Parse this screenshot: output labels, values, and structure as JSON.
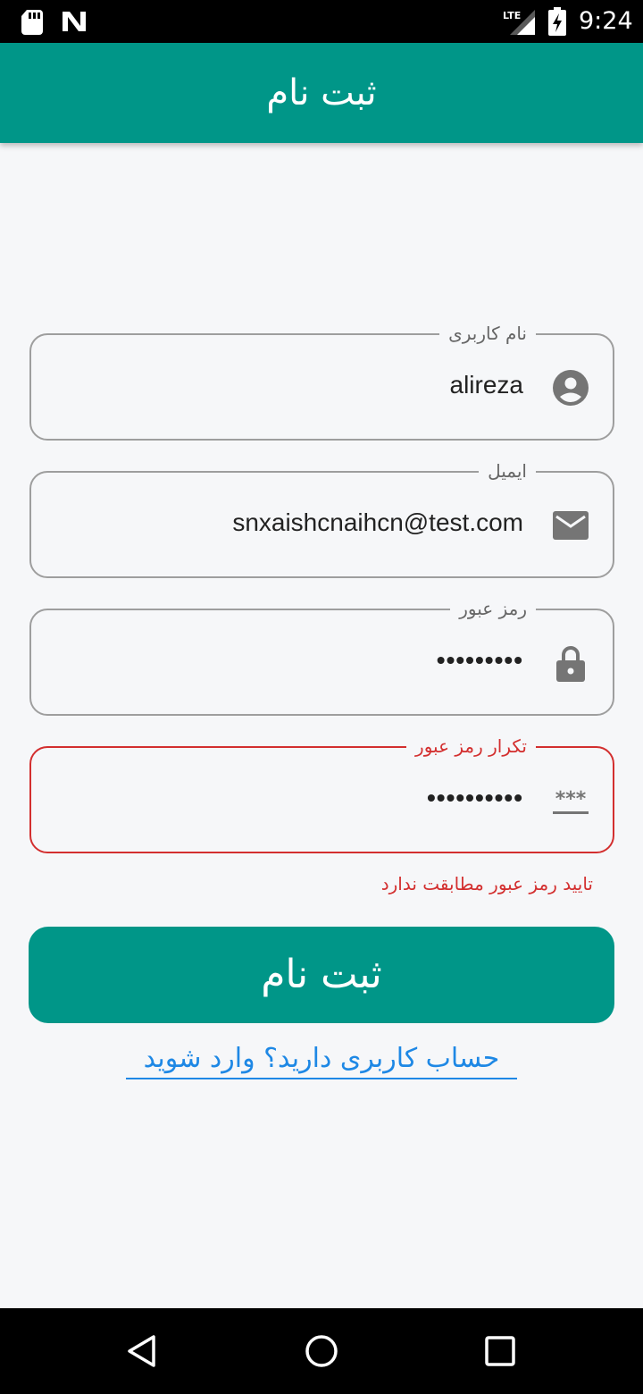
{
  "status_bar": {
    "time": "9:24",
    "network": "LTE"
  },
  "app_bar": {
    "title": "ثبت نام"
  },
  "form": {
    "username": {
      "label": "نام کاربری",
      "value": "alireza",
      "icon": "account-circle-icon"
    },
    "email": {
      "label": "ایمیل",
      "value": "snxaishcnaihcn@test.com",
      "icon": "email-icon"
    },
    "password": {
      "label": "رمز عبور",
      "value": "•••••••••",
      "icon": "lock-icon"
    },
    "confirm_password": {
      "label": "تکرار رمز عبور",
      "value": "••••••••••",
      "icon": "password-icon",
      "error": "تایید رمز عبور مطابقت ندارد"
    },
    "submit_label": "ثبت نام",
    "login_link": "حساب کاربری دارید؟ وارد شوید"
  },
  "colors": {
    "primary": "#009688",
    "error": "#d32f2f",
    "link": "#1e88e5",
    "background": "#f6f7f9"
  }
}
